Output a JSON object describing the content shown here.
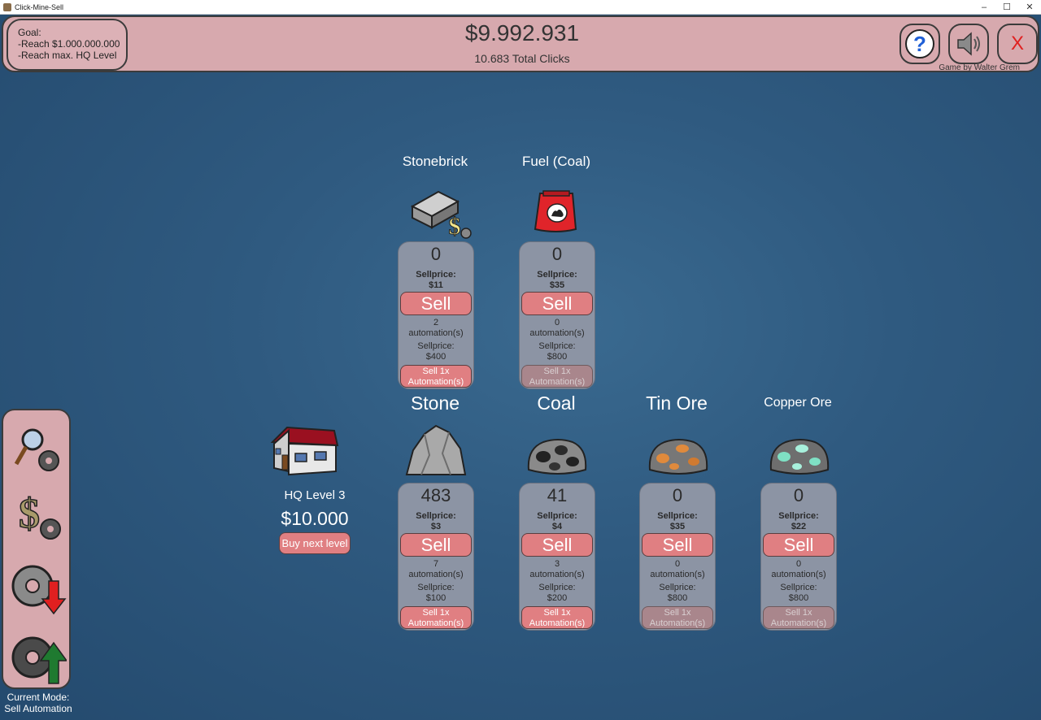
{
  "window": {
    "title": "Click-Mine-Sell",
    "controls": [
      "–",
      "☐",
      "✕"
    ]
  },
  "header": {
    "goal_title": "Goal:",
    "goal_line1": "-Reach $1.000.000.000",
    "goal_line2": "-Reach max. HQ Level",
    "money": "$9.992.931",
    "clicks": "10.683 Total Clicks",
    "help_label": "?",
    "close_label": "X",
    "credit": "Game by Walter Grem"
  },
  "hq": {
    "title": "HQ Level 3",
    "price": "$10.000",
    "buy_label": "Buy next level"
  },
  "processed": [
    {
      "name": "Stonebrick",
      "count": "0",
      "sellprice_label": "Sellprice:",
      "sellprice": "$11",
      "sell_label": "Sell",
      "automations": "2",
      "automations_label": "automation(s)",
      "auto_sellprice_label": "Sellprice:",
      "auto_sellprice": "$400",
      "auto_btn_line1": "Sell 1x",
      "auto_btn_line2": "Automation(s)"
    },
    {
      "name": "Fuel (Coal)",
      "count": "0",
      "sellprice_label": "Sellprice:",
      "sellprice": "$35",
      "sell_label": "Sell",
      "automations": "0",
      "automations_label": "automation(s)",
      "auto_sellprice_label": "Sellprice:",
      "auto_sellprice": "$800",
      "auto_btn_line1": "Sell 1x",
      "auto_btn_line2": "Automation(s)"
    }
  ],
  "ores": [
    {
      "name": "Stone",
      "count": "483",
      "sellprice_label": "Sellprice:",
      "sellprice": "$3",
      "sell_label": "Sell",
      "automations": "7",
      "automations_label": "automation(s)",
      "auto_sellprice_label": "Sellprice:",
      "auto_sellprice": "$100",
      "auto_btn_line1": "Sell 1x",
      "auto_btn_line2": "Automation(s)"
    },
    {
      "name": "Coal",
      "count": "41",
      "sellprice_label": "Sellprice:",
      "sellprice": "$4",
      "sell_label": "Sell",
      "automations": "3",
      "automations_label": "automation(s)",
      "auto_sellprice_label": "Sellprice:",
      "auto_sellprice": "$200",
      "auto_btn_line1": "Sell 1x",
      "auto_btn_line2": "Automation(s)"
    },
    {
      "name": "Tin Ore",
      "count": "0",
      "sellprice_label": "Sellprice:",
      "sellprice": "$35",
      "sell_label": "Sell",
      "automations": "0",
      "automations_label": "automation(s)",
      "auto_sellprice_label": "Sellprice:",
      "auto_sellprice": "$800",
      "auto_btn_line1": "Sell 1x",
      "auto_btn_line2": "Automation(s)"
    },
    {
      "name": "Copper Ore",
      "count": "0",
      "sellprice_label": "Sellprice:",
      "sellprice": "$22",
      "sell_label": "Sell",
      "automations": "0",
      "automations_label": "automation(s)",
      "auto_sellprice_label": "Sellprice:",
      "auto_sellprice": "$800",
      "auto_btn_line1": "Sell 1x",
      "auto_btn_line2": "Automation(s)"
    }
  ],
  "mode": {
    "line1": "Current Mode:",
    "line2": "Sell Automation"
  },
  "colors": {
    "panel": "#d7a9ae",
    "button": "#e07f82",
    "card": "#8c94a4",
    "background": "#2f5a80"
  },
  "icons": {
    "help": "question-mark-icon",
    "sound": "speaker-icon",
    "close": "close-icon",
    "inspect_automation": "magnifier-gear-icon",
    "sell_automation": "dollar-gear-icon",
    "downgrade_automation": "gear-arrow-down-icon",
    "upgrade_automation": "gear-arrow-up-icon",
    "hq": "house-icon"
  }
}
